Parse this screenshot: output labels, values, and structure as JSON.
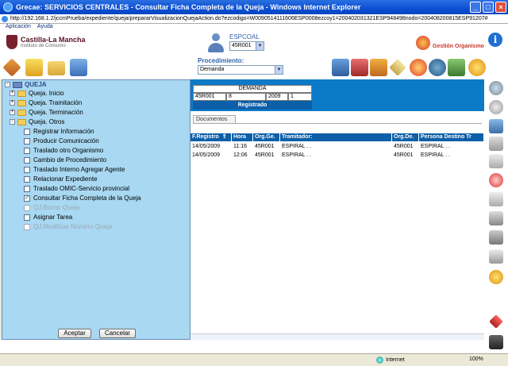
{
  "window": {
    "title": "Grecae: SERVICIOS CENTRALES - Consultar Ficha Completa de la Queja - Windows Internet Explorer",
    "address": "http://192.168.1.2/jccmPrueba/expediente/queja/prepararVisualizacionQuejaAction.do?ezcodigo=W0090514111606ESP0008ezcoy1=200402031321ESP948498nodo=200408200815ESP91207#"
  },
  "menu": [
    "Aplicación",
    "Ayuda"
  ],
  "header": {
    "logo_title": "Castilla-La Mancha",
    "logo_subtitle": "Instituto de Consumo",
    "user_label": "ESPCOAL",
    "user_select": "45R001",
    "gestion_label": "Gestión Organismo"
  },
  "toolbar": {
    "procedimiento_label": "Procedimiento:",
    "procedimiento_value": "Demanda"
  },
  "tree": {
    "root": "QUEJA",
    "items": [
      {
        "label": "Queja. Inicio",
        "type": "folder",
        "expander": "+"
      },
      {
        "label": "Queja. Tramitación",
        "type": "folder",
        "expander": "+"
      },
      {
        "label": "Queja. Terminación",
        "type": "folder",
        "expander": "+"
      },
      {
        "label": "Queja. Otros",
        "type": "folder",
        "expander": "-"
      },
      {
        "label": "Registrar Información",
        "type": "leaf"
      },
      {
        "label": "Producir Comunicación",
        "type": "leaf"
      },
      {
        "label": "Traslado otro Organismo",
        "type": "leaf"
      },
      {
        "label": "Cambio de Procedimiento",
        "type": "leaf"
      },
      {
        "label": "Traslado Interno Agregar Agente",
        "type": "leaf"
      },
      {
        "label": "Relacionar Expediente",
        "type": "leaf"
      },
      {
        "label": "Traslado OMIC-Servicio provincial",
        "type": "leaf"
      },
      {
        "label": "Consultar Ficha Completa de la Queja",
        "type": "leaf",
        "checked": "✓"
      },
      {
        "label": "QJ.Borrar Queja",
        "type": "leaf",
        "disabled": true
      },
      {
        "label": "Asignar Tarea",
        "type": "leaf"
      },
      {
        "label": "QJ.Modificar Número Queja",
        "type": "leaf",
        "disabled": true
      }
    ],
    "accept_label": "Aceptar",
    "cancel_label": "Cancelar"
  },
  "demanda": {
    "title": "DEMANDA",
    "cells": [
      "45R001",
      "8",
      "2009",
      "1"
    ],
    "status": "Registrado"
  },
  "tabs": {
    "documentos": "Documentos"
  },
  "grid": {
    "sort_icon": "⇑",
    "columns": [
      "F.Registro",
      "Hora",
      "Org.Ge.",
      "Tramitador:",
      "Org.De.",
      "Persona Destino Tr"
    ],
    "rows": [
      [
        "14/05/2009",
        "11:16",
        "45R001",
        "ESPIRAL . .",
        "45R001",
        "ESPIRAL . ."
      ],
      [
        "14/05/2009",
        "12:06",
        "45R001",
        "ESPIRAL . .",
        "45R001",
        "ESPIRAL . ."
      ]
    ]
  },
  "statusbar": {
    "zone": "Internet",
    "zoom": "100%"
  }
}
